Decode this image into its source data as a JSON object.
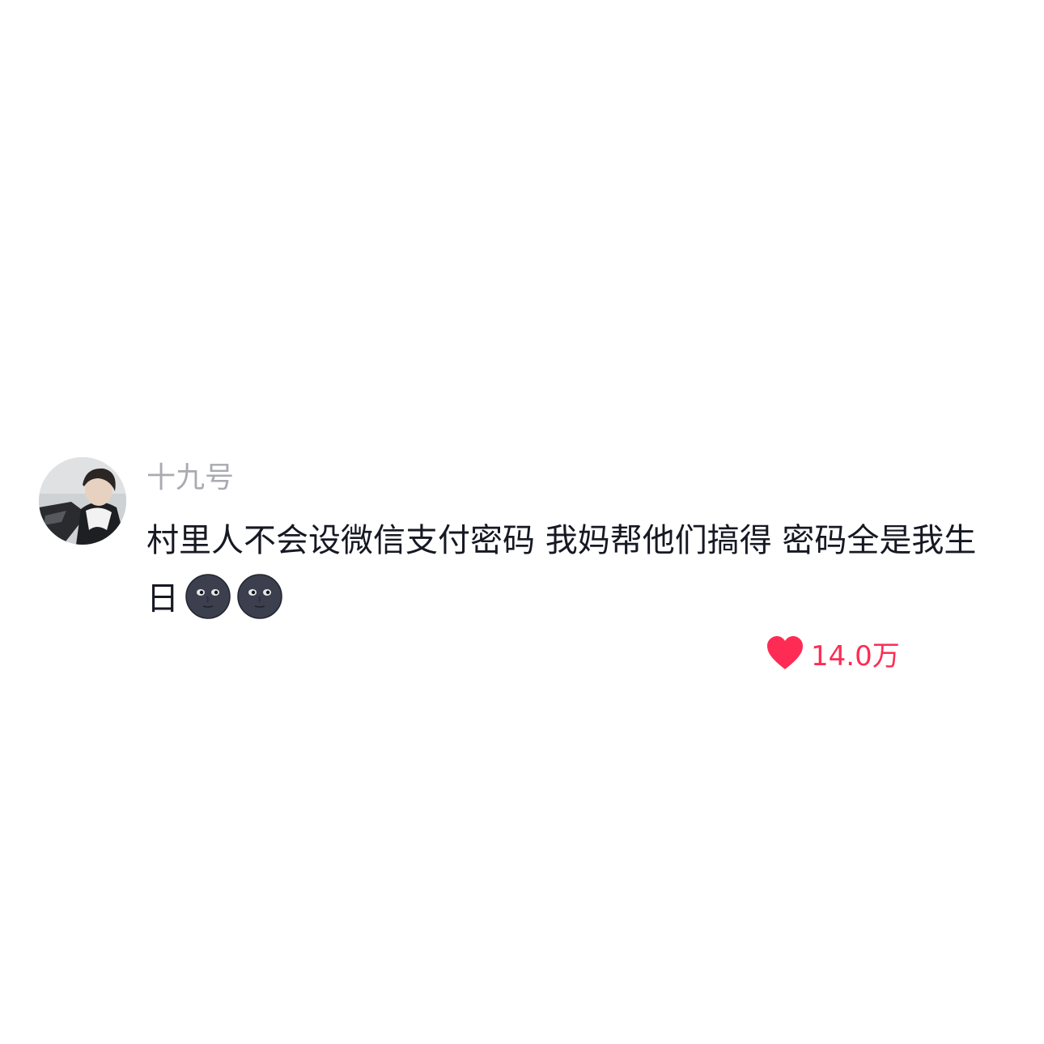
{
  "comment": {
    "username": "十九号",
    "text": "村里人不会设微信支付密码 我妈帮他们搞得 密码全是我生日",
    "emojis": [
      "new-moon-face-emoji",
      "new-moon-face-emoji"
    ],
    "like_count": "14.0万"
  },
  "colors": {
    "username": "#a9abb0",
    "text": "#161823",
    "like": "#fe2c55"
  }
}
